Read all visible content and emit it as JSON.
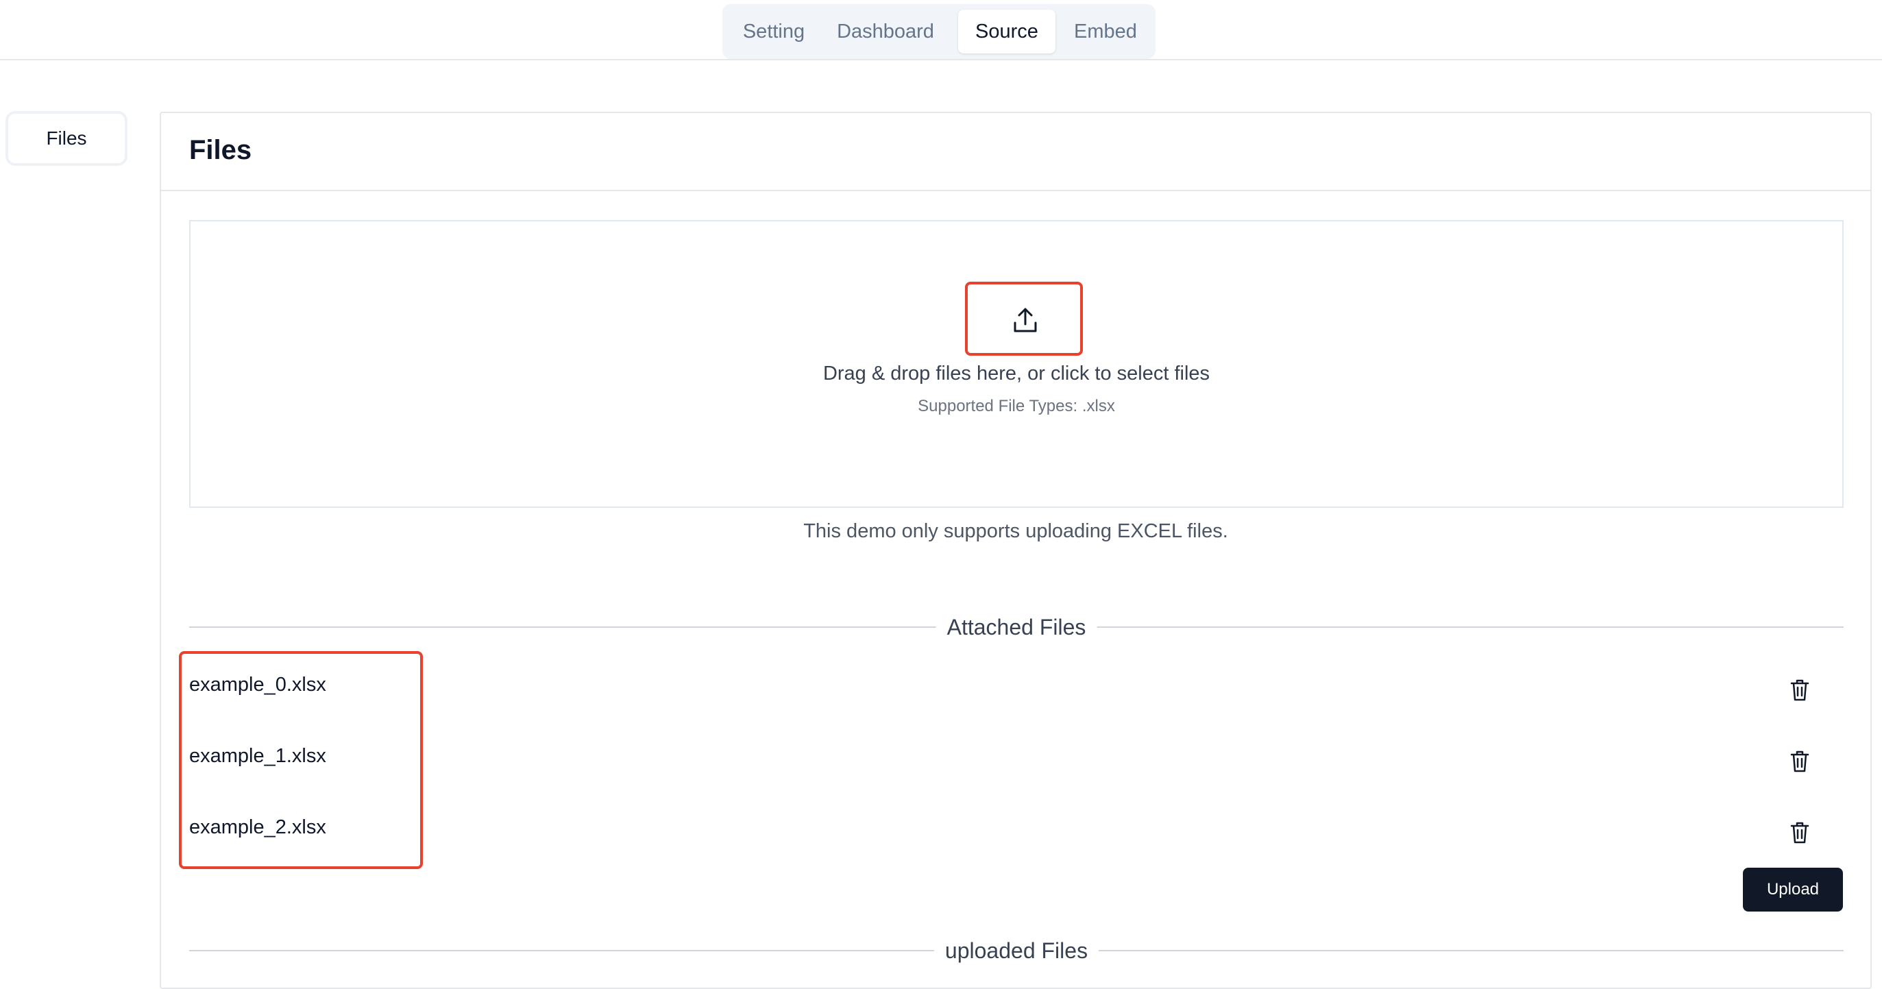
{
  "nav": {
    "tabs": [
      {
        "label": "Setting"
      },
      {
        "label": "Dashboard"
      },
      {
        "label": "Source"
      },
      {
        "label": "Embed"
      }
    ],
    "active_tab": "Source"
  },
  "sidebar": {
    "items": [
      {
        "label": "Files"
      }
    ]
  },
  "main": {
    "title": "Files",
    "dropzone": {
      "icon": "upload-icon",
      "text": "Drag & drop files here, or click to select files",
      "subtext": "Supported File Types: .xlsx"
    },
    "note": "This demo only supports uploading EXCEL files.",
    "attached": {
      "heading": "Attached Files",
      "files": [
        {
          "name": "example_0.xlsx",
          "action_icon": "trash-icon"
        },
        {
          "name": "example_1.xlsx",
          "action_icon": "trash-icon"
        },
        {
          "name": "example_2.xlsx",
          "action_icon": "trash-icon"
        }
      ],
      "upload_label": "Upload"
    },
    "uploaded": {
      "heading": "uploaded Files"
    }
  },
  "colors": {
    "highlight": "#e8422f",
    "primary_button": "#111827",
    "tab_bg": "#f1f5f9"
  }
}
